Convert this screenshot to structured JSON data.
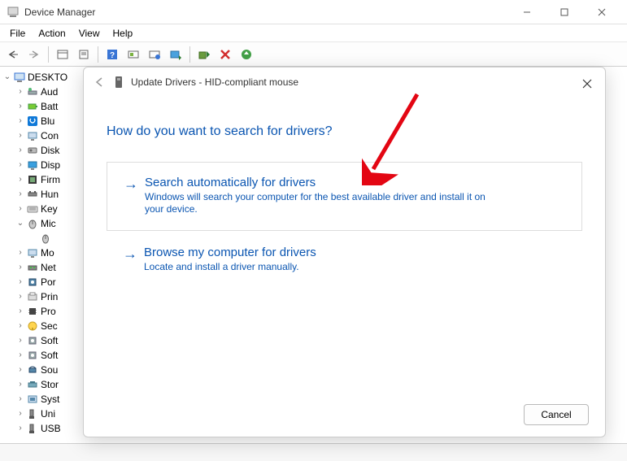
{
  "window": {
    "title": "Device Manager"
  },
  "menu": {
    "file": "File",
    "action": "Action",
    "view": "View",
    "help": "Help"
  },
  "tree": {
    "root": "DESKTO",
    "items": [
      "Aud",
      "Batt",
      "Blu",
      "Con",
      "Disk",
      "Disp",
      "Firm",
      "Hun",
      "Key",
      "Mic",
      "Mo",
      "Net",
      "Por",
      "Prin",
      "Pro",
      "Sec",
      "Soft",
      "Soft",
      "Sou",
      "Stor",
      "Syst",
      "Uni",
      "USB"
    ],
    "mouse_item": ""
  },
  "dialog": {
    "title": "Update Drivers - HID-compliant mouse",
    "heading": "How do you want to search for drivers?",
    "opt1_title": "Search automatically for drivers",
    "opt1_desc": "Windows will search your computer for the best available driver and install it on your device.",
    "opt2_title": "Browse my computer for drivers",
    "opt2_desc": "Locate and install a driver manually.",
    "cancel": "Cancel"
  }
}
